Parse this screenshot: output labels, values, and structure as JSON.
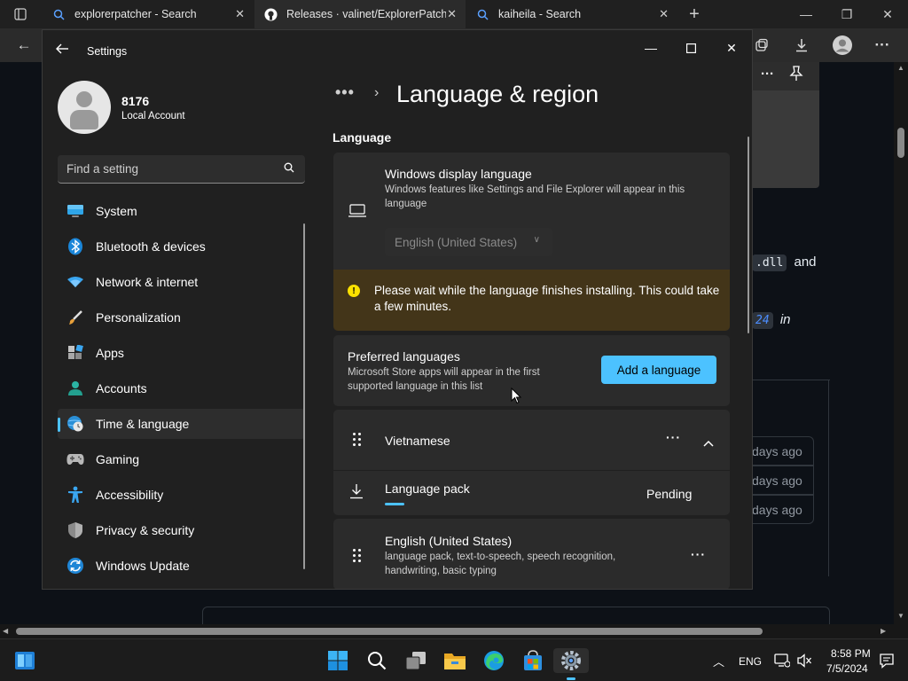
{
  "browser": {
    "tabs": [
      {
        "title": "explorerpatcher - Search",
        "icon": "search-icon"
      },
      {
        "title": "Releases · valinet/ExplorerPatcher",
        "icon": "github-icon"
      },
      {
        "title": "kaiheila - Search",
        "icon": "search-icon"
      }
    ]
  },
  "webpage": {
    "code_snippet": ".dll",
    "text_and": "and",
    "code_snippet2": "24",
    "text_in": "in",
    "rows": [
      "days ago",
      "days ago",
      "days ago"
    ]
  },
  "settings": {
    "window_title": "Settings",
    "user": {
      "name": "8176",
      "type": "Local Account"
    },
    "search_placeholder": "Find a setting",
    "nav": [
      {
        "label": "System",
        "icon": "monitor-icon"
      },
      {
        "label": "Bluetooth & devices",
        "icon": "bluetooth-icon"
      },
      {
        "label": "Network & internet",
        "icon": "wifi-icon"
      },
      {
        "label": "Personalization",
        "icon": "brush-icon"
      },
      {
        "label": "Apps",
        "icon": "apps-icon"
      },
      {
        "label": "Accounts",
        "icon": "accounts-icon"
      },
      {
        "label": "Time & language",
        "icon": "globe-clock-icon"
      },
      {
        "label": "Gaming",
        "icon": "gamepad-icon"
      },
      {
        "label": "Accessibility",
        "icon": "accessibility-icon"
      },
      {
        "label": "Privacy & security",
        "icon": "shield-icon"
      },
      {
        "label": "Windows Update",
        "icon": "update-icon"
      }
    ],
    "selected_nav": "Time & language",
    "breadcrumb_more": "•••",
    "page_title": "Language & region",
    "section_language": "Language",
    "display_language": {
      "title": "Windows display language",
      "desc": "Windows features like Settings and File Explorer will appear in this language",
      "value": "English (United States)"
    },
    "warning": "Please wait while the language finishes installing. This could take a few minutes.",
    "preferred": {
      "title": "Preferred languages",
      "desc": "Microsoft Store apps will appear in the first supported language in this list",
      "button": "Add a language"
    },
    "languages": [
      {
        "name": "Vietnamese",
        "pack_label": "Language pack",
        "pack_status": "Pending",
        "pack_progress_pct": 30
      },
      {
        "name": "English (United States)",
        "desc": "language pack, text-to-speech, speech recognition, handwriting, basic typing"
      }
    ]
  },
  "taskbar": {
    "lang": "ENG",
    "time": "8:58 PM",
    "date": "7/5/2024"
  },
  "colors": {
    "accent": "#4cc2ff",
    "warning_bg": "#433519",
    "warning_icon": "#fce100"
  }
}
